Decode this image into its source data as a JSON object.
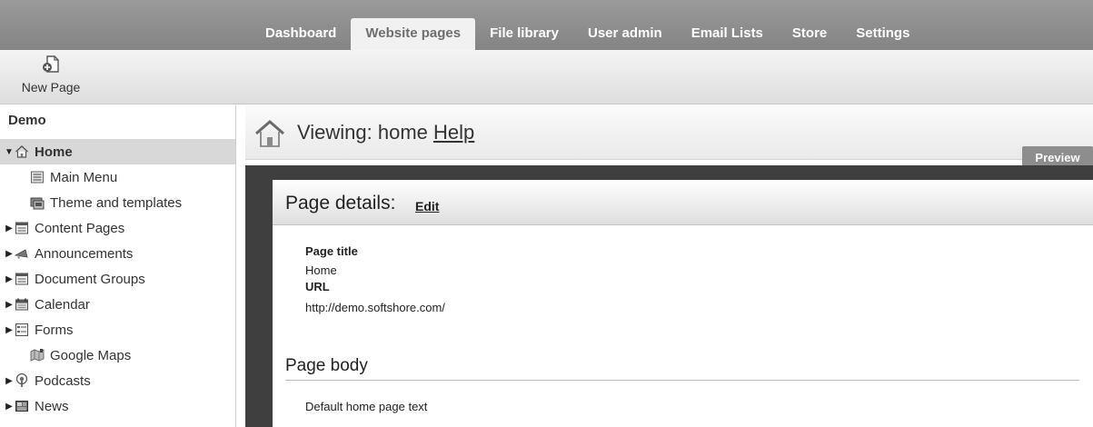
{
  "nav": {
    "tabs": [
      {
        "label": "Dashboard"
      },
      {
        "label": "Website pages"
      },
      {
        "label": "File library"
      },
      {
        "label": "User admin"
      },
      {
        "label": "Email Lists"
      },
      {
        "label": "Store"
      },
      {
        "label": "Settings"
      }
    ],
    "active_tab": "Website pages"
  },
  "toolbar": {
    "new_page_label": "New Page",
    "new_page_icon": "new-page-icon"
  },
  "sidebar": {
    "site_name": "Demo",
    "items": [
      {
        "label": "Home",
        "icon": "home-icon",
        "expander": "expanded",
        "selected": true
      },
      {
        "label": "Main Menu",
        "icon": "menu-icon",
        "expander": "none"
      },
      {
        "label": "Theme and templates",
        "icon": "theme-icon",
        "expander": "none"
      },
      {
        "label": "Content Pages",
        "icon": "content-pages-icon",
        "expander": "collapsed"
      },
      {
        "label": "Announcements",
        "icon": "announcements-icon",
        "expander": "collapsed"
      },
      {
        "label": "Document Groups",
        "icon": "document-groups-icon",
        "expander": "collapsed"
      },
      {
        "label": "Calendar",
        "icon": "calendar-icon",
        "expander": "collapsed"
      },
      {
        "label": "Forms",
        "icon": "forms-icon",
        "expander": "collapsed"
      },
      {
        "label": "Google Maps",
        "icon": "map-icon",
        "expander": "none"
      },
      {
        "label": "Podcasts",
        "icon": "podcast-icon",
        "expander": "collapsed"
      },
      {
        "label": "News",
        "icon": "news-icon",
        "expander": "collapsed"
      }
    ]
  },
  "main": {
    "viewing_text": "Viewing: home",
    "help_label": "Help",
    "preview_label": "Preview",
    "page_details_title": "Page details:",
    "edit_label": "Edit",
    "page_title_label": "Page title",
    "page_title_value": "Home",
    "url_label": "URL",
    "url_value": "http://demo.softshore.com/",
    "page_body_title": "Page body",
    "page_body_text": "Default home page text"
  },
  "colors": {
    "nav_bar": "#8f8f8f",
    "dark_frame": "#3f3f3f",
    "preview_button": "#8d8d8d",
    "selected_row": "#d8d8d8"
  }
}
